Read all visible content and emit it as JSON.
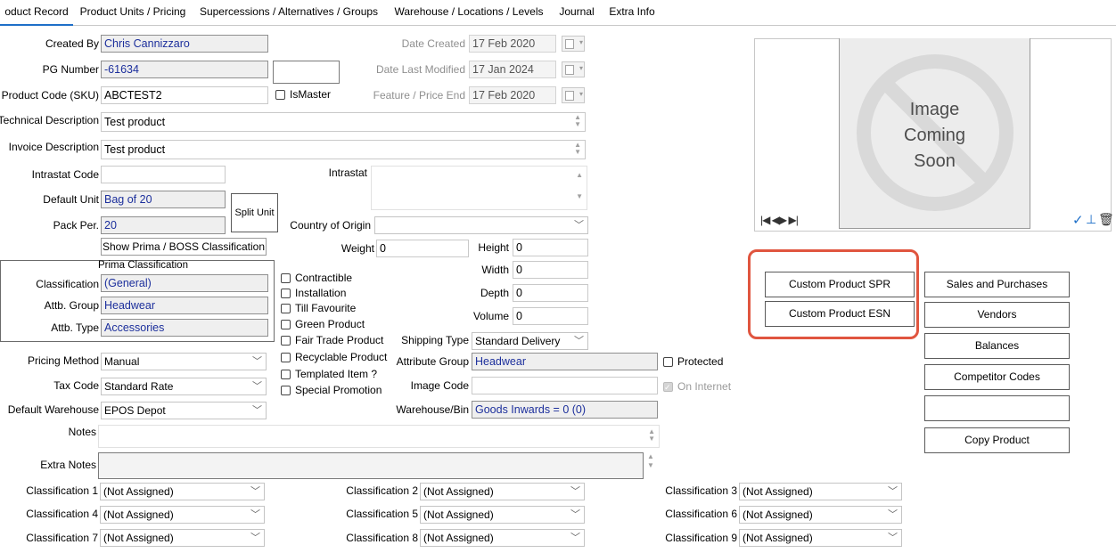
{
  "tabs": [
    "oduct Record",
    "Product Units / Pricing",
    "Supercessions / Alternatives / Groups",
    "Warehouse / Locations / Levels",
    "Journal",
    "Extra Info"
  ],
  "labels": {
    "created_by": "Created By",
    "pg_number": "PG Number",
    "product_code": "Product Code (SKU)",
    "technical_description": "Technical Description",
    "invoice_description": "Invoice Description",
    "intrastat_code": "Intrastat Code",
    "default_unit": "Default Unit",
    "pack_per": "Pack Per.",
    "date_created": "Date Created",
    "date_last_modified": "Date Last Modified",
    "feature_price_end": "Feature / Price End",
    "intrastat": "Intrastat",
    "country_of_origin": "Country of Origin",
    "weight": "Weight",
    "height": "Height",
    "width": "Width",
    "depth": "Depth",
    "volume": "Volume",
    "prima_classification": "Prima Classification",
    "classification": "Classification",
    "attb_group": "Attb. Group",
    "attb_type": "Attb. Type",
    "pricing_method": "Pricing Method",
    "tax_code": "Tax Code",
    "default_warehouse": "Default Warehouse",
    "shipping_type": "Shipping Type",
    "attribute_group": "Attribute Group",
    "image_code": "Image Code",
    "warehouse_bin": "Warehouse/Bin",
    "notes": "Notes",
    "extra_notes": "Extra Notes"
  },
  "values": {
    "created_by": "Chris Cannizzaro",
    "pg_number": "-61634",
    "product_code": "ABCTEST2",
    "technical_description": "Test product",
    "invoice_description": "Test product",
    "default_unit": "Bag of 20",
    "pack_per": "20",
    "date_created": "17 Feb 2020",
    "date_last_modified": "17 Jan 2024",
    "feature_price_end": "17 Feb 2020",
    "weight": "0",
    "height": "0",
    "width": "0",
    "depth": "0",
    "volume": "0",
    "classification": "(General)",
    "attb_group": "Headwear",
    "attb_type": "Accessories",
    "pricing_method": "Manual",
    "tax_code": "Standard Rate",
    "default_warehouse": "EPOS Depot",
    "shipping_type": "Standard Delivery",
    "attribute_group": "Headwear",
    "warehouse_bin": "Goods Inwards = 0 (0)"
  },
  "checkboxes": {
    "is_master": "IsMaster",
    "product_flags": [
      "Contractible",
      "Installation",
      "Till Favourite",
      "Green Product",
      "Fair Trade Product",
      "Recyclable Product",
      "Templated Item ?",
      "Special Promotion"
    ],
    "protected": "Protected",
    "on_internet": "On Internet"
  },
  "buttons": {
    "split_unit": "Split Unit",
    "show_prima": "Show Prima / BOSS Classification",
    "custom_spr": "Custom Product SPR",
    "custom_esn": "Custom Product ESN",
    "sales_purchases": "Sales and Purchases",
    "vendors": "Vendors",
    "balances": "Balances",
    "competitor_codes": "Competitor Codes",
    "blank": "",
    "copy_product": "Copy Product"
  },
  "image_panel": {
    "placeholder_lines": [
      "Image",
      "Coming",
      "Soon"
    ],
    "nav": "|◀ ◀▶ ▶|",
    "icons": [
      "check-icon",
      "upload-icon",
      "trash-icon"
    ]
  },
  "classifications": [
    {
      "label": "Classification 1",
      "value": "(Not Assigned)"
    },
    {
      "label": "Classification 2",
      "value": "(Not Assigned)"
    },
    {
      "label": "Classification 3",
      "value": "(Not Assigned)"
    },
    {
      "label": "Classification 4",
      "value": "(Not Assigned)"
    },
    {
      "label": "Classification 5",
      "value": "(Not Assigned)"
    },
    {
      "label": "Classification 6",
      "value": "(Not Assigned)"
    },
    {
      "label": "Classification 7",
      "value": "(Not Assigned)"
    },
    {
      "label": "Classification 8",
      "value": "(Not Assigned)"
    },
    {
      "label": "Classification 9",
      "value": "(Not Assigned)"
    }
  ],
  "colors": {
    "highlight": "#e0553f",
    "tab_active": "#1e6fc8",
    "readonly_text": "#1c2f9c",
    "icon_blue": "#1e6fc8"
  }
}
